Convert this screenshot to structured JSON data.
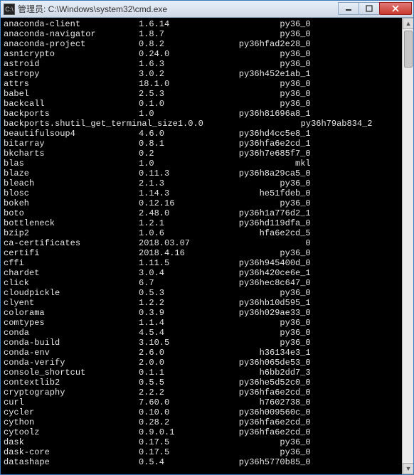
{
  "titlebar": {
    "icon_label": "C:\\",
    "text": "管理员: C:\\Windows\\system32\\cmd.exe"
  },
  "packages": [
    {
      "name": "anaconda-client",
      "version": "1.6.14",
      "build": "py36_0"
    },
    {
      "name": "anaconda-navigator",
      "version": "1.8.7",
      "build": "py36_0"
    },
    {
      "name": "anaconda-project",
      "version": "0.8.2",
      "build": "py36hfad2e28_0"
    },
    {
      "name": "asn1crypto",
      "version": "0.24.0",
      "build": "py36_0"
    },
    {
      "name": "astroid",
      "version": "1.6.3",
      "build": "py36_0"
    },
    {
      "name": "astropy",
      "version": "3.0.2",
      "build": "py36h452e1ab_1"
    },
    {
      "name": "attrs",
      "version": "18.1.0",
      "build": "py36_0"
    },
    {
      "name": "babel",
      "version": "2.5.3",
      "build": "py36_0"
    },
    {
      "name": "backcall",
      "version": "0.1.0",
      "build": "py36_0"
    },
    {
      "name": "backports",
      "version": "1.0",
      "build": "py36h81696a8_1"
    },
    {
      "name": "backports.shutil_get_terminal_size",
      "version": "1.0.0",
      "build": "py36h79ab834_2"
    },
    {
      "name": "beautifulsoup4",
      "version": "4.6.0",
      "build": "py36hd4cc5e8_1"
    },
    {
      "name": "bitarray",
      "version": "0.8.1",
      "build": "py36hfa6e2cd_1"
    },
    {
      "name": "bkcharts",
      "version": "0.2",
      "build": "py36h7e685f7_0"
    },
    {
      "name": "blas",
      "version": "1.0",
      "build": "mkl"
    },
    {
      "name": "blaze",
      "version": "0.11.3",
      "build": "py36h8a29ca5_0"
    },
    {
      "name": "bleach",
      "version": "2.1.3",
      "build": "py36_0"
    },
    {
      "name": "blosc",
      "version": "1.14.3",
      "build": "he51fdeb_0"
    },
    {
      "name": "bokeh",
      "version": "0.12.16",
      "build": "py36_0"
    },
    {
      "name": "boto",
      "version": "2.48.0",
      "build": "py36h1a776d2_1"
    },
    {
      "name": "bottleneck",
      "version": "1.2.1",
      "build": "py36hd119dfa_0"
    },
    {
      "name": "bzip2",
      "version": "1.0.6",
      "build": "hfa6e2cd_5"
    },
    {
      "name": "ca-certificates",
      "version": "2018.03.07",
      "build": "0"
    },
    {
      "name": "certifi",
      "version": "2018.4.16",
      "build": "py36_0"
    },
    {
      "name": "cffi",
      "version": "1.11.5",
      "build": "py36h945400d_0"
    },
    {
      "name": "chardet",
      "version": "3.0.4",
      "build": "py36h420ce6e_1"
    },
    {
      "name": "click",
      "version": "6.7",
      "build": "py36hec8c647_0"
    },
    {
      "name": "cloudpickle",
      "version": "0.5.3",
      "build": "py36_0"
    },
    {
      "name": "clyent",
      "version": "1.2.2",
      "build": "py36hb10d595_1"
    },
    {
      "name": "colorama",
      "version": "0.3.9",
      "build": "py36h029ae33_0"
    },
    {
      "name": "comtypes",
      "version": "1.1.4",
      "build": "py36_0"
    },
    {
      "name": "conda",
      "version": "4.5.4",
      "build": "py36_0"
    },
    {
      "name": "conda-build",
      "version": "3.10.5",
      "build": "py36_0"
    },
    {
      "name": "conda-env",
      "version": "2.6.0",
      "build": "h36134e3_1"
    },
    {
      "name": "conda-verify",
      "version": "2.0.0",
      "build": "py36h065de53_0"
    },
    {
      "name": "console_shortcut",
      "version": "0.1.1",
      "build": "h6bb2dd7_3"
    },
    {
      "name": "contextlib2",
      "version": "0.5.5",
      "build": "py36he5d52c0_0"
    },
    {
      "name": "cryptography",
      "version": "2.2.2",
      "build": "py36hfa6e2cd_0"
    },
    {
      "name": "curl",
      "version": "7.60.0",
      "build": "h7602738_0"
    },
    {
      "name": "cycler",
      "version": "0.10.0",
      "build": "py36h009560c_0"
    },
    {
      "name": "cython",
      "version": "0.28.2",
      "build": "py36hfa6e2cd_0"
    },
    {
      "name": "cytoolz",
      "version": "0.9.0.1",
      "build": "py36hfa6e2cd_0"
    },
    {
      "name": "dask",
      "version": "0.17.5",
      "build": "py36_0"
    },
    {
      "name": "dask-core",
      "version": "0.17.5",
      "build": "py36_0"
    },
    {
      "name": "datashape",
      "version": "0.5.4",
      "build": "py36h5770b85_0"
    }
  ]
}
